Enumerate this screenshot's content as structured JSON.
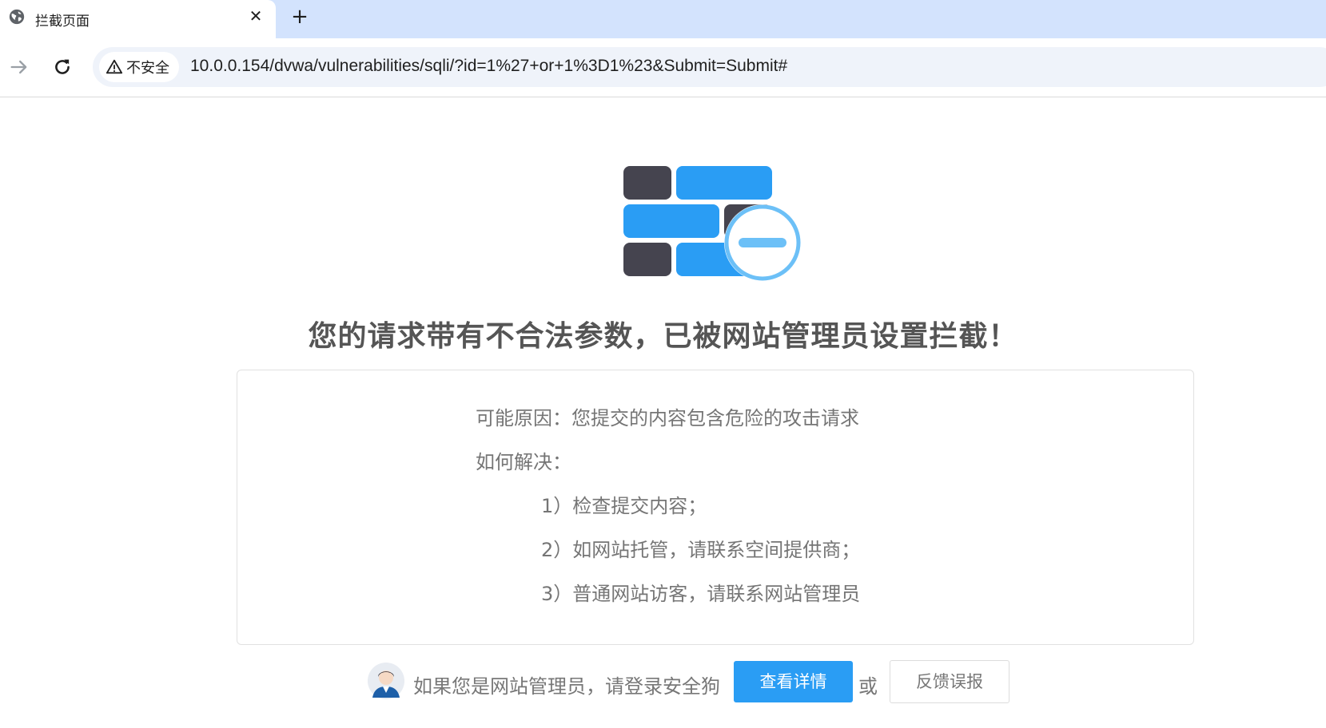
{
  "browser": {
    "tab": {
      "title": "拦截页面",
      "favicon_icon": "globe-icon",
      "close_icon": "close-icon",
      "close_glyph": "✕"
    },
    "new_tab_glyph": "+",
    "toolbar": {
      "forward_icon": "arrow-right-icon",
      "reload_icon": "reload-icon"
    },
    "omnibox": {
      "security_label": "不安全",
      "security_icon": "warning-triangle-icon",
      "url": "10.0.0.154/dvwa/vulnerabilities/sqli/?id=1%27+or+1%3D1%23&Submit=Submit#"
    }
  },
  "page": {
    "heading": "您的请求带有不合法参数，已被网站管理员设置拦截！",
    "reason": "可能原因：您提交的内容包含危险的攻击请求",
    "how_to_resolve": "如何解决：",
    "steps": [
      "1）检查提交内容；",
      "2）如网站托管，请联系空间提供商；",
      "3）普通网站访客，请联系网站管理员"
    ],
    "footer": {
      "admin_prompt": "如果您是网站管理员，请登录安全狗",
      "details_button": "查看详情",
      "or_text": "或",
      "feedback_button": "反馈误报"
    }
  },
  "colors": {
    "accent_blue": "#2a9df4",
    "brick_dark": "#45444f",
    "badge_light_blue": "#6cc0f7",
    "text_gray": "#757575",
    "heading_gray": "#555555",
    "tabbar_bg": "#d3e3fd"
  }
}
